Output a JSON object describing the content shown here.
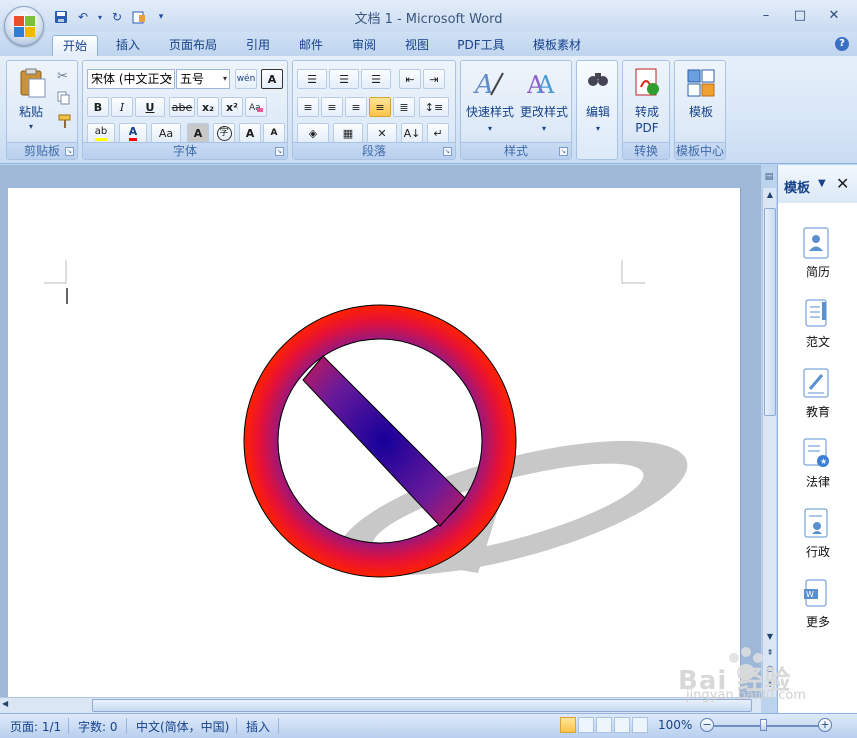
{
  "window": {
    "title": "文档 1 - Microsoft Word",
    "controls": [
      "–",
      "□",
      "✕"
    ]
  },
  "tabs": [
    "开始",
    "插入",
    "页面布局",
    "引用",
    "邮件",
    "审阅",
    "视图",
    "PDF工具",
    "模板素材"
  ],
  "ribbon": {
    "clipboard": {
      "label": "剪贴板",
      "paste": "粘贴"
    },
    "font": {
      "label": "字体",
      "font_name": "宋体 (中文正文",
      "font_size": "五号",
      "bold": "B",
      "italic": "I",
      "underline": "U",
      "strike": "abe",
      "subscript": "x₂",
      "superscript": "x²",
      "highlight": "ab",
      "font_color": "A",
      "change_case": "Aa",
      "char_shading": "A",
      "enclose": "字",
      "grow": "A",
      "shrink": "A",
      "phonetic": "wén",
      "char_border": "A"
    },
    "paragraph": {
      "label": "段落"
    },
    "styles": {
      "label": "样式",
      "quick_styles": "快速样式",
      "change_styles": "更改样式"
    },
    "editing": {
      "label": "编辑"
    },
    "convert": {
      "label": "转换",
      "to_pdf_line1": "转成",
      "to_pdf_line2": "PDF"
    },
    "template_center": {
      "label": "模板中心",
      "template": "模板"
    }
  },
  "task_pane": {
    "title": "模板",
    "items": [
      "简历",
      "范文",
      "教育",
      "法律",
      "行政",
      "更多"
    ]
  },
  "status": {
    "page": "页面: 1/1",
    "words": "字数: 0",
    "language": "中文(简体，中国)",
    "mode": "插入",
    "zoom": "100%"
  },
  "watermark": {
    "brand": "Bai 经验",
    "url": "jingyan.baidu.com"
  },
  "colors": {
    "ring_inner": "#8a1a8a",
    "ring_outer": "#ff2200",
    "bar_center": "#15009a",
    "shadow": "#c8c8c8"
  }
}
